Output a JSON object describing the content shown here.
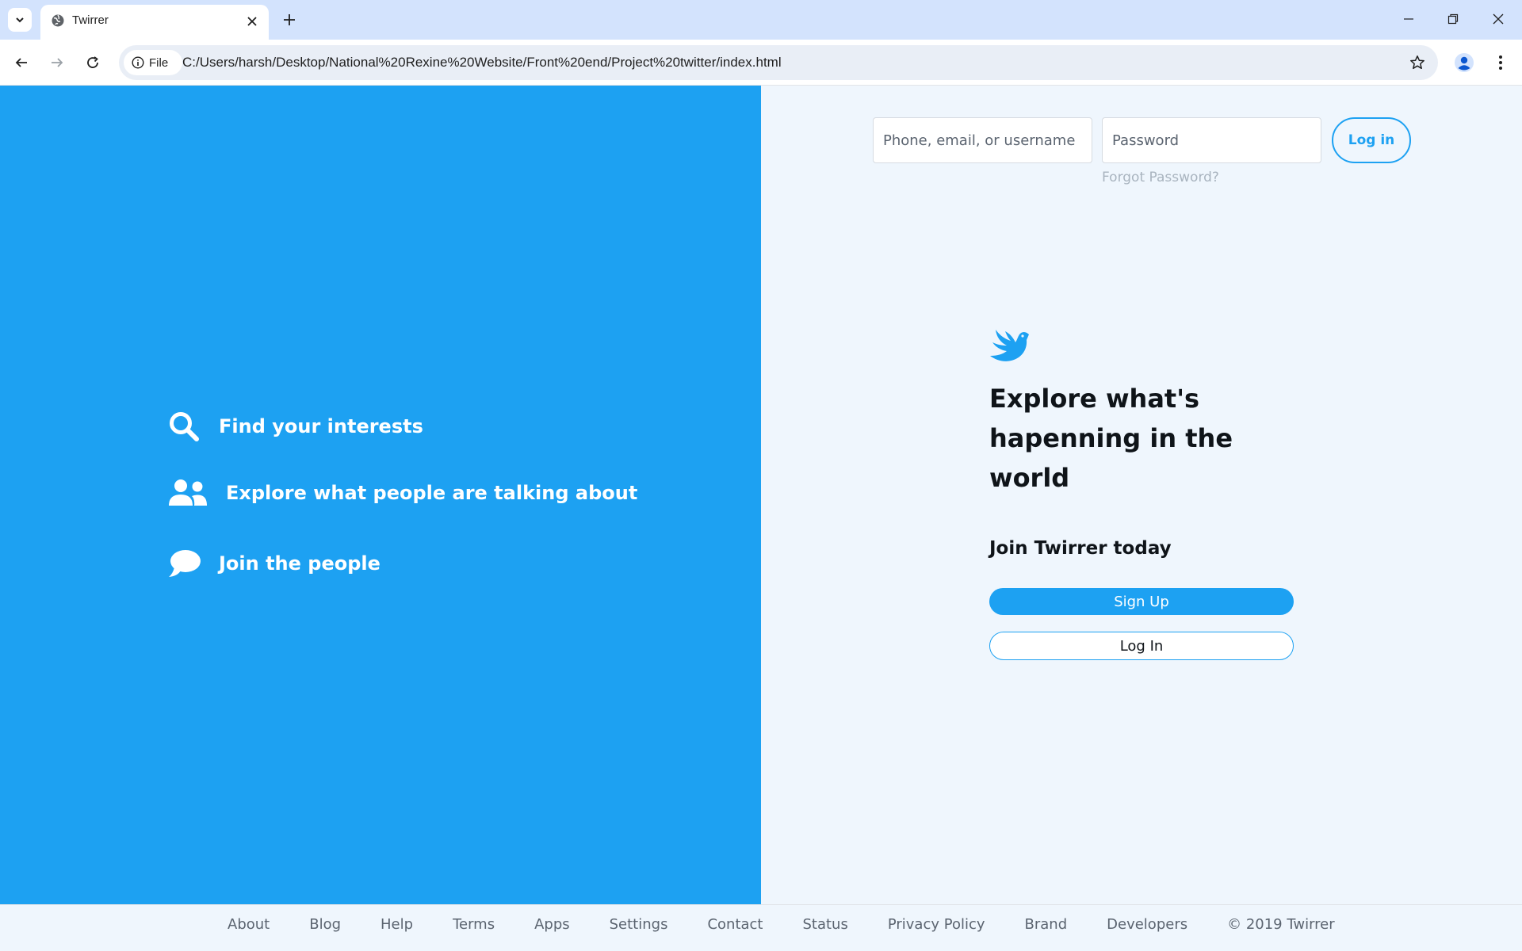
{
  "browser": {
    "tab_title": "Twirrer",
    "site_chip_label": "File",
    "url": "C:/Users/harsh/Desktop/National%20Rexine%20Website/Front%20end/Project%20twitter/index.html"
  },
  "features": [
    {
      "icon": "search-icon",
      "label": "Find your interests"
    },
    {
      "icon": "users-icon",
      "label": "Explore what people are talking about"
    },
    {
      "icon": "chat-bubble-icon",
      "label": "Join the people"
    }
  ],
  "login_form": {
    "username_placeholder": "Phone, email, or username",
    "password_placeholder": "Password",
    "login_label": "Log in",
    "forgot_label": "Forgot Password?"
  },
  "hero": {
    "headline": "Explore what's hapenning in the world",
    "join_label": "Join Twirrer today",
    "signup_label": "Sign Up",
    "login_label": "Log In"
  },
  "footer": {
    "links": [
      "About",
      "Blog",
      "Help",
      "Terms",
      "Apps",
      "Settings",
      "Contact",
      "Status",
      "Privacy Policy",
      "Brand",
      "Developers"
    ],
    "copyright": "© 2019 Twirrer"
  },
  "colors": {
    "brand": "#1da1f2",
    "right_bg": "#eff6fd",
    "tabbar_bg": "#d3e3fd"
  }
}
